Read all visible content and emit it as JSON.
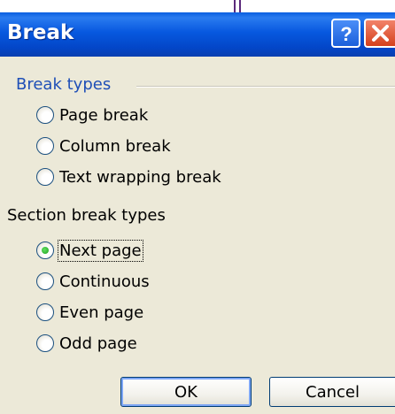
{
  "dialog": {
    "title": "Break",
    "help_label": "?",
    "close_label": "X"
  },
  "break_types": {
    "label": "Break types",
    "options": [
      {
        "label": "Page break",
        "selected": false
      },
      {
        "label": "Column break",
        "selected": false
      },
      {
        "label": "Text wrapping break",
        "selected": false
      }
    ]
  },
  "section_break_types": {
    "label": "Section break types",
    "options": [
      {
        "label": "Next page",
        "selected": true
      },
      {
        "label": "Continuous",
        "selected": false
      },
      {
        "label": "Even page",
        "selected": false
      },
      {
        "label": "Odd page",
        "selected": false
      }
    ]
  },
  "buttons": {
    "ok": "OK",
    "cancel": "Cancel"
  },
  "colors": {
    "titlebar": "#0758df",
    "dialog_background": "#ece9d8",
    "group_label": "#1f4fb7",
    "radio_selected": "#21a121"
  },
  "icons": {
    "help": "help-icon",
    "close": "close-icon"
  }
}
